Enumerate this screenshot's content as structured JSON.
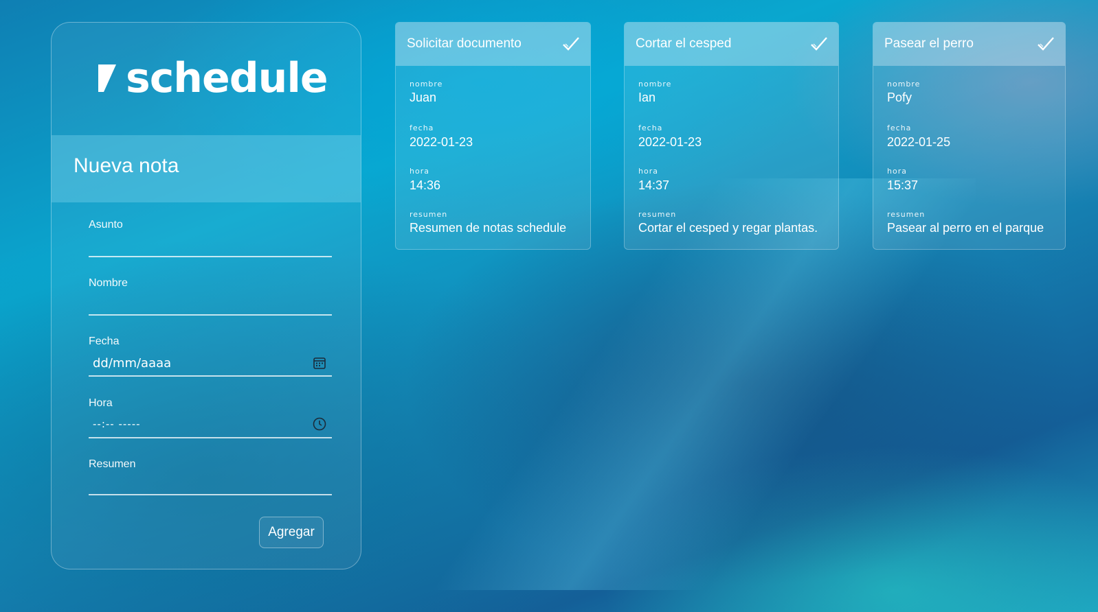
{
  "logo": {
    "text": "schedule"
  },
  "form": {
    "title": "Nueva nota",
    "fields": [
      {
        "label": "Asunto",
        "value": ""
      },
      {
        "label": "Nombre",
        "value": ""
      },
      {
        "label": "Fecha",
        "value": "dd/mm/aaaa",
        "icon": "calendar-icon"
      },
      {
        "label": "Hora",
        "value": "--:-- -----",
        "icon": "clock-icon"
      },
      {
        "label": "Resumen",
        "value": ""
      }
    ],
    "submit_label": "Agregar"
  },
  "notes": [
    {
      "title": "Solicitar documento",
      "nombre_label": "nombre",
      "nombre": "Juan",
      "fecha_label": "fecha",
      "fecha": "2022-01-23",
      "hora_label": "hora",
      "hora": "14:36",
      "resumen_label": "resumen",
      "resumen": "Resumen de notas schedule"
    },
    {
      "title": "Cortar el cesped",
      "nombre_label": "nombre",
      "nombre": "Ian",
      "fecha_label": "fecha",
      "fecha": "2022-01-23",
      "hora_label": "hora",
      "hora": "14:37",
      "resumen_label": "resumen",
      "resumen": "Cortar el cesped y regar plantas."
    },
    {
      "title": "Pasear el perro",
      "nombre_label": "nombre",
      "nombre": "Pofy",
      "fecha_label": "fecha",
      "fecha": "2022-01-25",
      "hora_label": "hora",
      "hora": "15:37",
      "resumen_label": "resumen",
      "resumen": "Pasear al perro en el parque"
    }
  ],
  "colors": {
    "accent": "#ffffff",
    "background": "#0f8fbf"
  }
}
